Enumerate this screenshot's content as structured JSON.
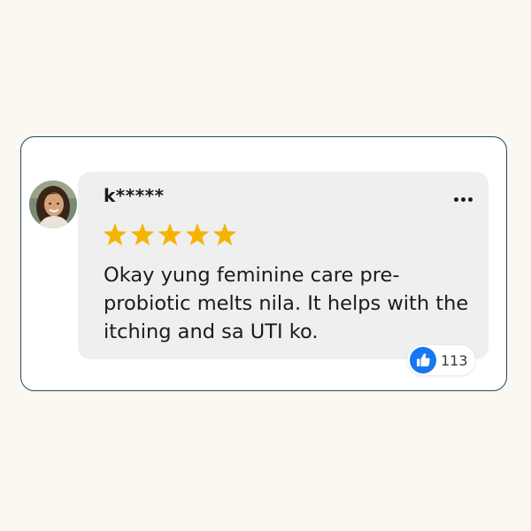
{
  "review": {
    "username": "k*****",
    "rating": 5,
    "rating_max": 5,
    "text": "Okay yung feminine care pre-probiotic melts nila. It helps with the itching and sa UTI ko.",
    "likes": "113"
  },
  "icons": {
    "avatar": "avatar",
    "more": "more-options-icon",
    "star": "star-icon",
    "like": "thumbs-up-icon"
  },
  "colors": {
    "background": "#fbf7f1",
    "card_border": "#1f4a5c",
    "bubble": "#efefef",
    "star": "#f5b400",
    "like_blue": "#1877f2"
  }
}
